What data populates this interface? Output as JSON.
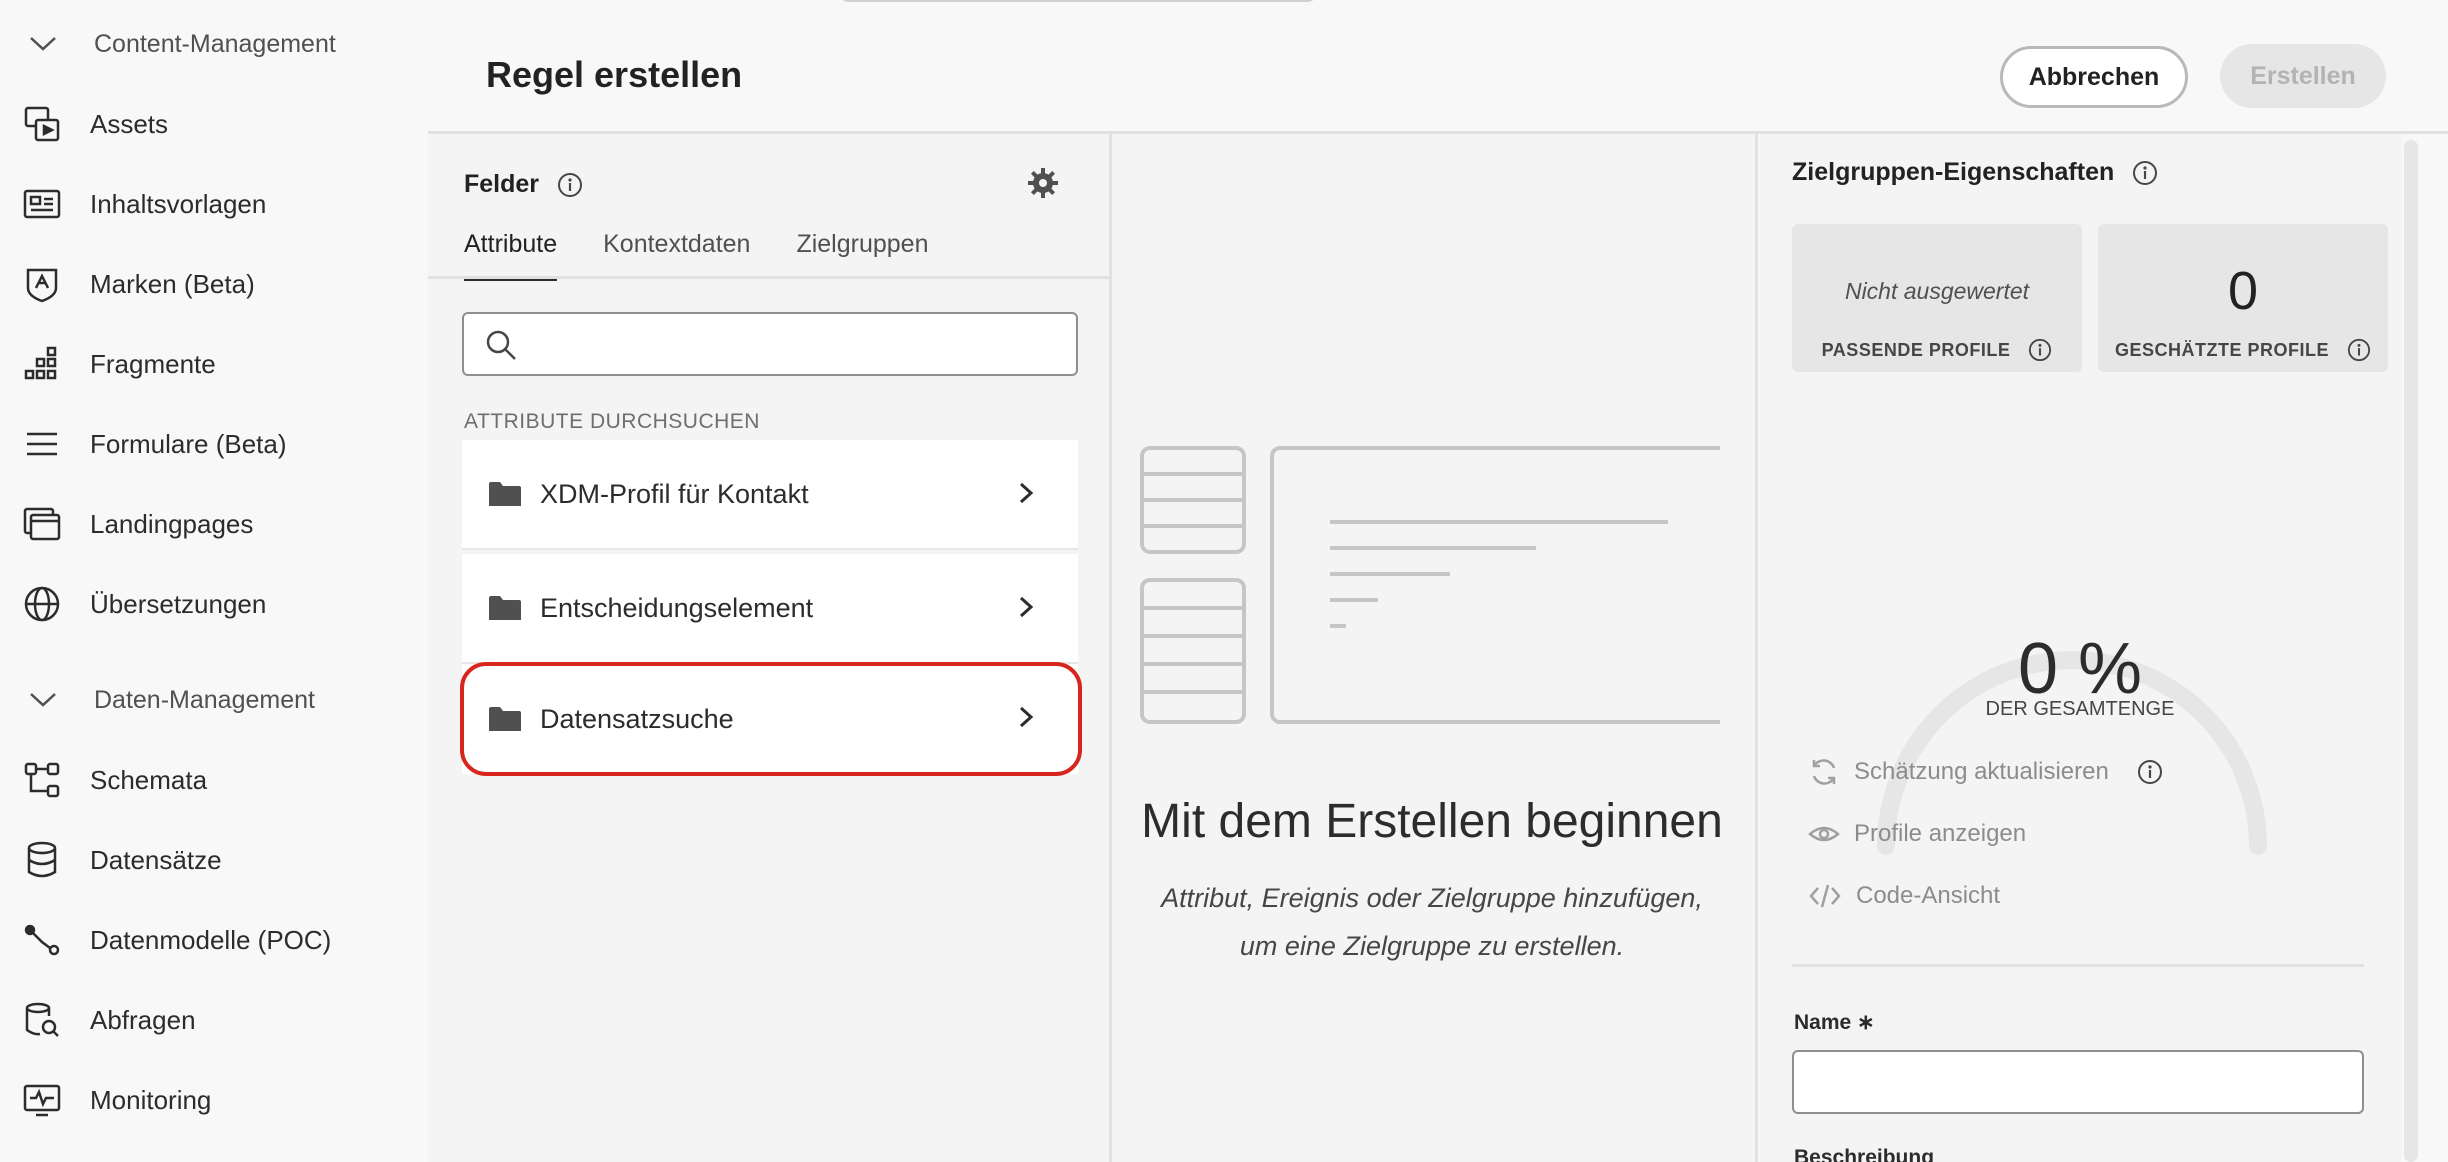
{
  "nav": {
    "section_content": "Content-Management",
    "section_data": "Daten-Management",
    "content_items": [
      {
        "label": "Assets",
        "icon": "assets-icon"
      },
      {
        "label": "Inhaltsvorlagen",
        "icon": "content-templates-icon"
      },
      {
        "label": "Marken (Beta)",
        "icon": "brands-icon"
      },
      {
        "label": "Fragmente",
        "icon": "fragments-icon"
      },
      {
        "label": "Formulare (Beta)",
        "icon": "forms-icon"
      },
      {
        "label": "Landingpages",
        "icon": "landing-pages-icon"
      },
      {
        "label": "Übersetzungen",
        "icon": "globe-icon"
      }
    ],
    "data_items": [
      {
        "label": "Schemata",
        "icon": "schemas-icon"
      },
      {
        "label": "Datensätze",
        "icon": "datasets-icon"
      },
      {
        "label": "Datenmodelle (POC)",
        "icon": "data-models-icon"
      },
      {
        "label": "Abfragen",
        "icon": "queries-icon"
      },
      {
        "label": "Monitoring",
        "icon": "monitoring-icon"
      }
    ]
  },
  "header": {
    "title": "Regel erstellen",
    "cancel_label": "Abbrechen",
    "create_label": "Erstellen"
  },
  "fields": {
    "title": "Felder",
    "tabs": [
      {
        "label": "Attribute",
        "active": true
      },
      {
        "label": "Kontextdaten",
        "active": false
      },
      {
        "label": "Zielgruppen",
        "active": false
      }
    ],
    "search_value": "",
    "browse_label": "ATTRIBUTE DURCHSUCHEN",
    "folders": [
      {
        "label": "XDM-Profil für Kontakt"
      },
      {
        "label": "Entscheidungselement"
      },
      {
        "label": "Datensatzsuche",
        "highlighted": true
      }
    ]
  },
  "canvas": {
    "empty_title": "Mit dem Erstellen beginnen",
    "empty_sub_line1": "Attribut, Ereignis oder Zielgruppe hinzufügen,",
    "empty_sub_line2": "um eine Zielgruppe zu erstellen."
  },
  "audience": {
    "title": "Zielgruppen-Eigenschaften",
    "matching_value": "Nicht ausgewertet",
    "matching_label": "PASSENDE PROFILE",
    "estimated_value": "0",
    "estimated_label": "GESCHÄTZTE PROFILE",
    "gauge_value": "0 %",
    "gauge_fraction": 0,
    "gauge_label": "DER GESAMTENGE",
    "refresh_label": "Schätzung aktualisieren",
    "view_profiles_label": "Profile anzeigen",
    "code_view_label": "Code-Ansicht",
    "name_label": "Name",
    "name_value": "",
    "description_label": "Beschreibung"
  },
  "colors": {
    "highlight": "#d7261d",
    "background": "#f8f8f8",
    "panel": "#f4f4f4"
  }
}
